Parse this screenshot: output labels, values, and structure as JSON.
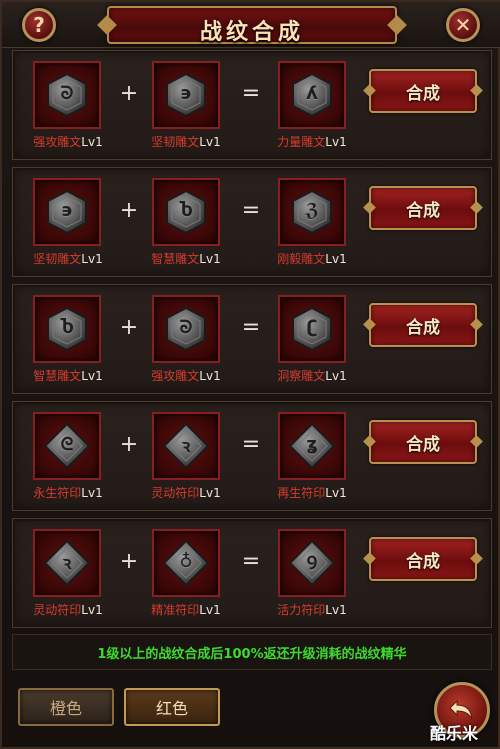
{
  "header": {
    "title": "战纹合成",
    "help_label": "?",
    "close_label": "✕"
  },
  "rows": [
    {
      "a": {
        "name": "强攻雕文",
        "lv": "Lv1",
        "glyph": "ᘐ",
        "shape": "hex"
      },
      "b": {
        "name": "坚韧雕文",
        "lv": "Lv1",
        "glyph": "϶",
        "shape": "hex"
      },
      "r": {
        "name": "力量雕文",
        "lv": "Lv1",
        "glyph": "ʎ",
        "shape": "hex"
      },
      "plus": "+",
      "equals": "=",
      "button": "合成"
    },
    {
      "a": {
        "name": "坚韧雕文",
        "lv": "Lv1",
        "glyph": "϶",
        "shape": "hex"
      },
      "b": {
        "name": "智慧雕文",
        "lv": "Lv1",
        "glyph": "Ⴆ",
        "shape": "hex"
      },
      "r": {
        "name": "刚毅雕文",
        "lv": "Lv1",
        "glyph": "ℨ",
        "shape": "hex"
      },
      "plus": "+",
      "equals": "=",
      "button": "合成"
    },
    {
      "a": {
        "name": "智慧雕文",
        "lv": "Lv1",
        "glyph": "Ⴆ",
        "shape": "hex"
      },
      "b": {
        "name": "强攻雕文",
        "lv": "Lv1",
        "glyph": "ᘐ",
        "shape": "hex"
      },
      "r": {
        "name": "洞察雕文",
        "lv": "Lv1",
        "glyph": "ʗ",
        "shape": "hex"
      },
      "plus": "+",
      "equals": "=",
      "button": "合成"
    },
    {
      "a": {
        "name": "永生符印",
        "lv": "Lv1",
        "glyph": "ᘓ",
        "shape": "diamond"
      },
      "b": {
        "name": "灵动符印",
        "lv": "Lv1",
        "glyph": "ꝛ",
        "shape": "diamond"
      },
      "r": {
        "name": "再生符印",
        "lv": "Lv1",
        "glyph": "ʓ",
        "shape": "diamond"
      },
      "plus": "+",
      "equals": "=",
      "button": "合成"
    },
    {
      "a": {
        "name": "灵动符印",
        "lv": "Lv1",
        "glyph": "ꝛ",
        "shape": "diamond"
      },
      "b": {
        "name": "精准符印",
        "lv": "Lv1",
        "glyph": "♁",
        "shape": "diamond"
      },
      "r": {
        "name": "活力符印",
        "lv": "Lv1",
        "glyph": "Ꝯ",
        "shape": "diamond"
      },
      "plus": "+",
      "equals": "=",
      "button": "合成"
    }
  ],
  "info": "1级以上的战纹合成后100%返还升级消耗的战纹精华",
  "tabs": {
    "orange": "橙色",
    "red": "红色"
  },
  "watermark": "酷乐米",
  "colors": {
    "accent_red": "#8a1d1d",
    "gold": "#b7924f",
    "label_red": "#d83a2c",
    "info_green": "#3ddb2e"
  }
}
